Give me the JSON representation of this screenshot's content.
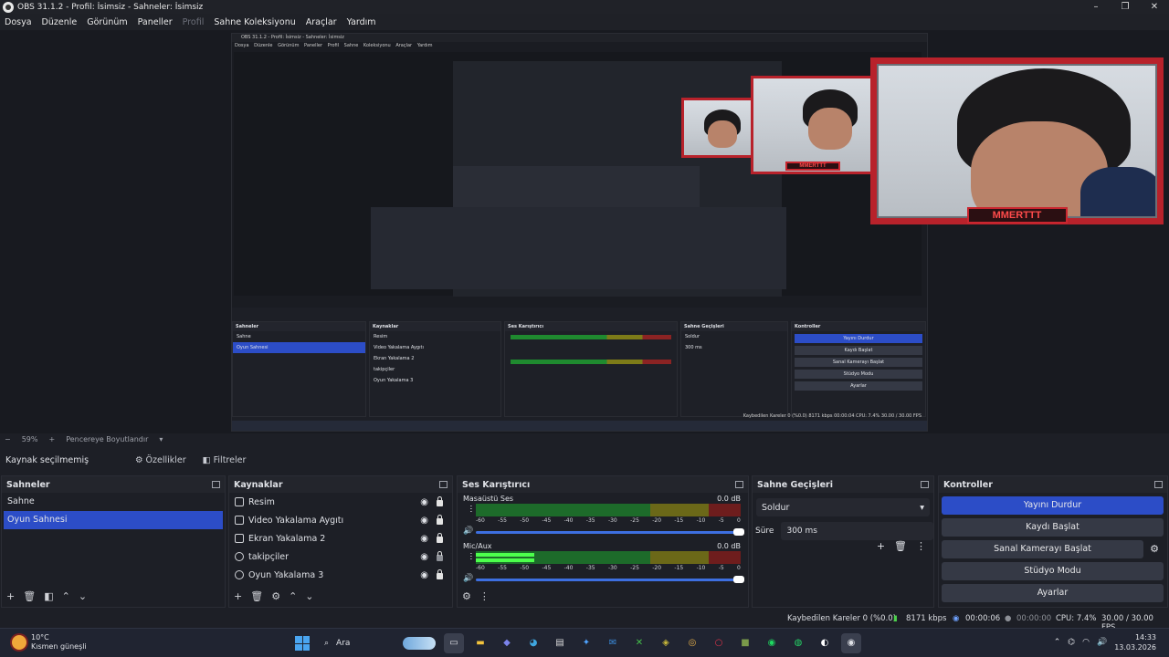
{
  "window": {
    "title": "OBS 31.1.2 - Profil: İsimsiz - Sahneler: İsimsiz",
    "controls": [
      "–",
      "❐",
      "✕"
    ]
  },
  "menu": [
    "Dosya",
    "Düzenle",
    "Görünüm",
    "Paneller",
    "Profil",
    "Sahne Koleksiyonu",
    "Araçlar",
    "Yardım"
  ],
  "preview": {
    "nested_title": "OBS 31.1.2 - Profil: İsimsiz - Sahneler: İsimsiz",
    "nested_menu": "Dosya Düzenle Görünüm Paneller Profil Sahne Koleksiyonu Araçlar Yardım",
    "overlay_badge": "MMERTTT",
    "nested_status": "Kaybedilen Kareler 0 (%0.0)   8171 kbps   00:00:04   CPU: 7.4%   30.00 / 30.00 FPS"
  },
  "zoom": {
    "value": "59%",
    "resize_label": "Pencereye Boyutlandır"
  },
  "source_toolbar": {
    "label": "Kaynak seçilmemiş",
    "properties": "Özellikler",
    "filters": "Filtreler"
  },
  "scenes": {
    "title": "Sahneler",
    "items": [
      {
        "label": "Sahne",
        "selected": false
      },
      {
        "label": "Oyun Sahnesi",
        "selected": true
      }
    ]
  },
  "sources": {
    "title": "Kaynaklar",
    "items": [
      {
        "label": "Resim",
        "icon": "image-icon",
        "locked": true
      },
      {
        "label": "Video Yakalama Aygıtı",
        "icon": "camera-icon",
        "locked": true
      },
      {
        "label": "Ekran Yakalama 2",
        "icon": "monitor-icon",
        "locked": true
      },
      {
        "label": "takipçiler",
        "icon": "browser-icon",
        "locked": false
      },
      {
        "label": "Oyun Yakalama 3",
        "icon": "gamepad-icon",
        "locked": true
      }
    ]
  },
  "mixer": {
    "title": "Ses Karıştırıcı",
    "channels": [
      {
        "name": "Masaüstü Ses",
        "db": "0.0 dB",
        "level": 0.0
      },
      {
        "name": "Mic/Aux",
        "db": "0.0 dB",
        "level": 0.22
      }
    ],
    "ticks": [
      "-60",
      "-55",
      "-50",
      "-45",
      "-40",
      "-35",
      "-30",
      "-25",
      "-20",
      "-15",
      "-10",
      "-5",
      "0"
    ]
  },
  "transitions": {
    "title": "Sahne Geçişleri",
    "selected": "Soldur",
    "duration_label": "Süre",
    "duration_value": "300 ms"
  },
  "controls": {
    "title": "Kontroller",
    "buttons": [
      "Yayını Durdur",
      "Kaydı Başlat",
      "Sanal Kamerayı Başlat",
      "Stüdyo Modu",
      "Ayarlar"
    ]
  },
  "status": {
    "dropped": "Kaybedilen Kareler 0 (%0.0)",
    "bitrate": "8171 kbps",
    "stream_time": "00:00:06",
    "rec_time": "00:00:00",
    "cpu": "CPU: 7.4%",
    "fps": "30.00 / 30.00 FPS"
  },
  "taskbar": {
    "temp": "10°C",
    "weather": "Kısmen güneşli",
    "search": "Ara",
    "time": "14:33",
    "date": "13.03.2026"
  },
  "colors": {
    "accent": "#2c4dc7",
    "overlay_red": "#b8222b",
    "meter_green": "#4cff4c"
  }
}
